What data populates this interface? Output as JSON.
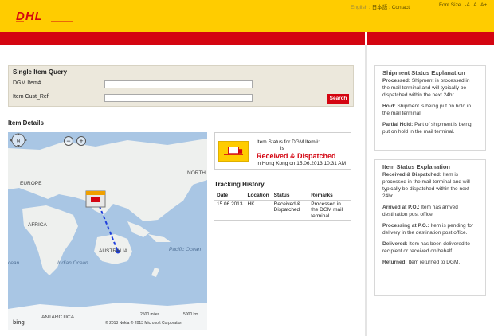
{
  "header": {
    "brand": "DHL",
    "lang_english": "English",
    "sep1": ":",
    "lang_japanese": "日本語",
    "sep2": ":",
    "contact": "Contact",
    "font_size_label": "Font Size",
    "font_small": "-A",
    "font_normal": "A",
    "font_large": "A+",
    "colors": {
      "yellow": "#ffcc00",
      "red": "#d40511"
    }
  },
  "query": {
    "title": "Single Item Query",
    "dgm_label": "DGM Item#",
    "dgm_value": "",
    "ref_label": "Item Cust_Ref",
    "ref_value": "",
    "search_label": "Search"
  },
  "item_details": {
    "title": "Item Details"
  },
  "map": {
    "labels": {
      "europe": "EUROPE",
      "africa": "AFRICA",
      "north": "NORTH",
      "australia": "AUSTRALIA",
      "indian_ocean": "Indian Ocean",
      "pacific_ocean": "Pacific Ocean",
      "ocean_left": "cean",
      "antarctica": "ANTARCTICA"
    },
    "nav_label": "N",
    "zoom_out": "−",
    "zoom_in": "+",
    "scale_miles": "2500 miles",
    "scale_km": "5000 km",
    "attribution": "© 2013 Nokia   © 2013 Microsoft Corporation",
    "bing": "bing"
  },
  "status": {
    "label": "Item Status for DGM Item#:",
    "is": "is",
    "main": "Received & Dispatched",
    "location": "in Hong Kong on 15.06.2013 10:31 AM",
    "icon": "truck-icon"
  },
  "tracking": {
    "title": "Tracking History",
    "columns": [
      "Date",
      "Location",
      "Status",
      "Remarks"
    ],
    "rows": [
      [
        "15.06.2013",
        "HK",
        "Received & Dispatched",
        "Processed in the DGM mail terminal"
      ]
    ]
  },
  "shipment_panel": {
    "title": "Shipment Status Explanation",
    "items": [
      {
        "term": "Processed:",
        "desc": "Shipment is processed in the mail terminal and will typically be dispatched within the next 24hr."
      },
      {
        "term": "Hold:",
        "desc": "Shipment is being put on hold in the mail terminal."
      },
      {
        "term": "Partial Hold:",
        "desc": "Part of shipment is being put on hold in the mail terminal."
      }
    ]
  },
  "item_panel": {
    "title": "Item Status Explanation",
    "items": [
      {
        "term": "Received & Dispatched:",
        "desc": "Item is processed in the mail terminal and will typically be dispatched within the next 24hr."
      },
      {
        "term": "Arrived at P.O.:",
        "desc": "Item has arrived destination post office."
      },
      {
        "term": "Processing at P.O.:",
        "desc": "Item is pending for delivery in the destination post office."
      },
      {
        "term": "Delivered:",
        "desc": "Item has been delivered to recipient or received on behalf."
      },
      {
        "term": "Returned:",
        "desc": "Item returned to DGM."
      }
    ]
  }
}
